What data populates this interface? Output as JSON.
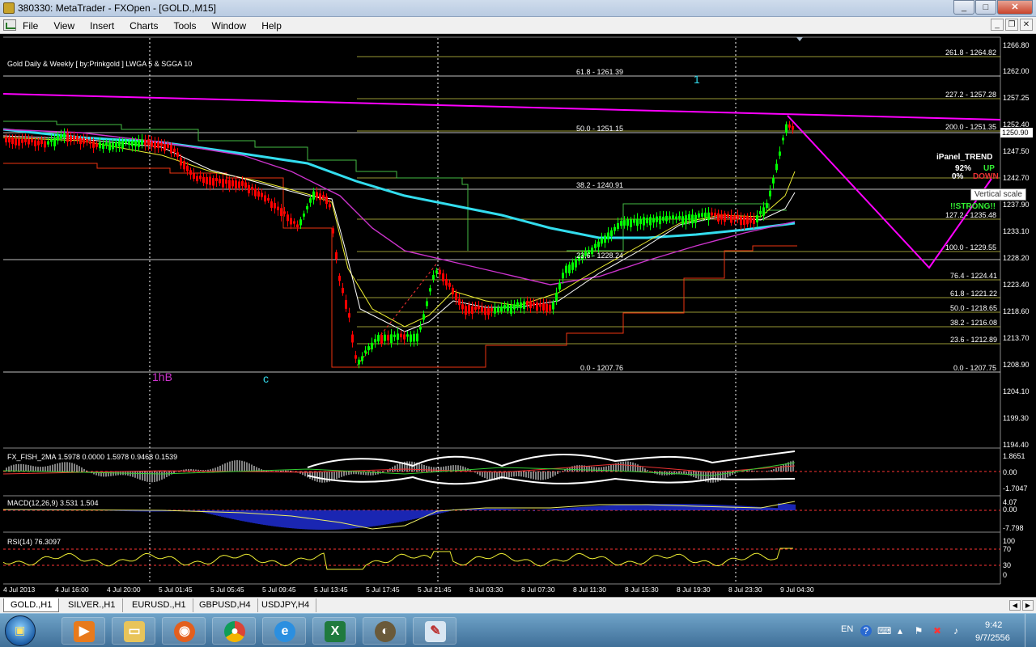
{
  "window": {
    "title": "380330: MetaTrader - FXOpen - [GOLD.,M15]",
    "btn_minimize": "_",
    "btn_maximize": "□",
    "btn_close": "✕"
  },
  "menu": {
    "items": [
      "File",
      "View",
      "Insert",
      "Charts",
      "Tools",
      "Window",
      "Help"
    ],
    "mdi_minimize": "_",
    "mdi_restore": "❐",
    "mdi_close": "✕"
  },
  "chart": {
    "info_label": "Gold Daily & Weekly [ by:Prinkgold ]  LWGA 5  &  SGGA 10",
    "current_price": "1250.90",
    "price_ticks": [
      "1266.80",
      "1262.00",
      "1257.25",
      "1252.40",
      "1247.50",
      "1242.70",
      "1237.90",
      "1233.10",
      "1228.20",
      "1223.40",
      "1218.60",
      "1213.70",
      "1208.90",
      "1204.10",
      "1199.30",
      "1194.40"
    ],
    "time_ticks": [
      "4 Jul 2013",
      "4 Jul 16:00",
      "4 Jul 20:00",
      "5 Jul 01:45",
      "5 Jul 05:45",
      "5 Jul 09:45",
      "5 Jul 13:45",
      "5 Jul 17:45",
      "5 Jul 21:45",
      "8 Jul 03:30",
      "8 Jul 07:30",
      "8 Jul 11:30",
      "8 Jul 15:30",
      "8 Jul 19:30",
      "8 Jul 23:30",
      "9 Jul 04:30"
    ],
    "fib_left": [
      "61.8 - 1261.39",
      "50.0 - 1251.15",
      "38.2 - 1240.91",
      "23.6 - 1228.24",
      "0.0 - 1207.76"
    ],
    "fib_right": [
      "261.8 - 1264.82",
      "227.2 - 1257.28",
      "200.0 - 1251.35",
      "127.2 - 1235.48",
      "100.0 - 1229.55",
      "76.4 - 1224.41",
      "61.8 - 1221.22",
      "50.0 - 1218.65",
      "38.2 - 1216.08",
      "23.6 - 1212.89",
      "0.0 - 1207.75"
    ],
    "wave_labels": {
      "one": "1",
      "lhb": "1hB",
      "c": "c"
    },
    "ipanel": {
      "title": "iPanel_TREND",
      "pct_up": "92%",
      "up": "UP",
      "pct_down": "0%",
      "down": "DOWN",
      "strength": "!!STRONG!!"
    },
    "tooltip": "Vertical scale"
  },
  "indicators": {
    "fish": {
      "label": "FX_FISH_2MA 1.5978 0.0000 1.5978 0.9468 0.1539",
      "ticks": [
        "1.8651",
        "0.00",
        "-1.7047"
      ]
    },
    "macd": {
      "label": "MACD(12,26,9) 3.531 1.504",
      "ticks": [
        "4.07",
        "0.00",
        "-7.798"
      ]
    },
    "rsi": {
      "label": "RSI(14) 76.3097",
      "ticks": [
        "100",
        "70",
        "30",
        "0"
      ]
    }
  },
  "tabs": [
    "GOLD.,H1",
    "SILVER.,H1",
    "EURUSD.,H1",
    "GBPUSD,H4",
    "USDJPY,H4"
  ],
  "taskbar": {
    "lang": "EN",
    "time": "9:42",
    "date": "9/7/2556",
    "apps": [
      "media-player",
      "file-explorer",
      "firefox",
      "chrome",
      "internet-explorer",
      "excel",
      "metatrader",
      "paint"
    ]
  },
  "colors": {
    "bull_candle": "#00ff00",
    "bear_candle": "#ff0000",
    "trend_line": "#ff00ff",
    "ma_cyan": "#33ddee",
    "fib_line": "#cccc44",
    "grid_dotted": "#ffffff"
  }
}
